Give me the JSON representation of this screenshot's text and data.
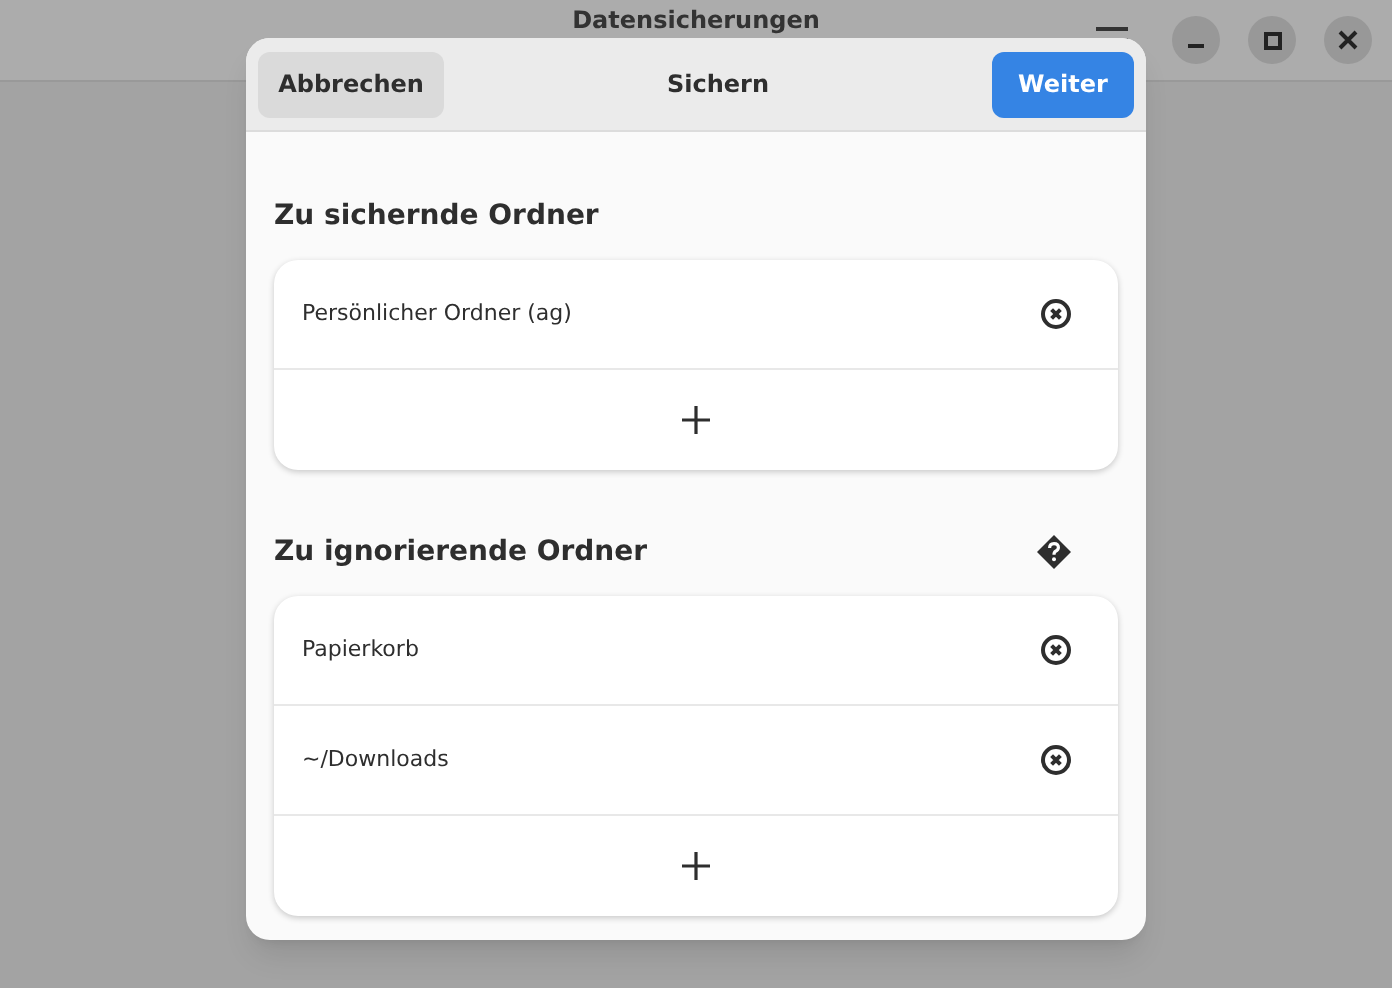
{
  "window": {
    "title": "Datensicherungen"
  },
  "dialog": {
    "cancel": "Abbrechen",
    "title": "Sichern",
    "next": "Weiter",
    "sections": [
      {
        "title": "Zu sichernde Ordner",
        "help": false,
        "items": [
          "Persönlicher Ordner (ag)"
        ]
      },
      {
        "title": "Zu ignorierende Ordner",
        "help": true,
        "items": [
          "Papierkorb",
          "~/Downloads"
        ]
      }
    ]
  }
}
